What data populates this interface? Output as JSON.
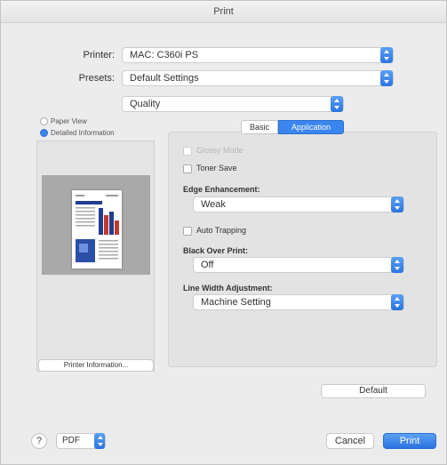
{
  "window": {
    "title": "Print"
  },
  "printer": {
    "label": "Printer:",
    "value": "MAC: C360i PS"
  },
  "presets": {
    "label": "Presets:",
    "value": "Default Settings"
  },
  "pane_select": {
    "value": "Quality"
  },
  "preview": {
    "paper_view_label": "Paper View",
    "detailed_info_label": "Detailed Information",
    "printer_info_button": "Printer Information..."
  },
  "tabs": {
    "basic": "Basic",
    "application": "Application"
  },
  "options": {
    "glossy_mode": "Glossy Mode",
    "toner_save": "Toner Save",
    "edge_enhancement": {
      "label": "Edge Enhancement:",
      "value": "Weak"
    },
    "auto_trapping": "Auto Trapping",
    "black_over_print": {
      "label": "Black Over Print:",
      "value": "Off"
    },
    "line_width": {
      "label": "Line Width Adjustment:",
      "value": "Machine Setting"
    }
  },
  "buttons": {
    "default": "Default",
    "help": "?",
    "pdf": "PDF",
    "cancel": "Cancel",
    "print": "Print"
  },
  "colors": {
    "accent": "#3b86ee",
    "window_bg": "#ececec"
  }
}
